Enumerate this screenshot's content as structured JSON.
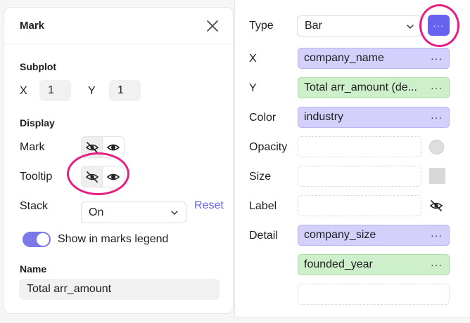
{
  "mark_panel": {
    "title": "Mark",
    "subplot": {
      "heading": "Subplot",
      "x_label": "X",
      "x_value": "1",
      "y_label": "Y",
      "y_value": "1"
    },
    "display": {
      "heading": "Display",
      "mark_label": "Mark",
      "tooltip_label": "Tooltip",
      "stack_label": "Stack",
      "stack_value": "On",
      "reset_label": "Reset"
    },
    "legend_toggle": {
      "label": "Show in marks legend",
      "on": true
    },
    "name": {
      "heading": "Name",
      "value": "Total arr_amount"
    }
  },
  "encoding_panel": {
    "type_label": "Type",
    "type_value": "Bar",
    "more_label": "···",
    "x_label": "X",
    "x_field": "company_name",
    "y_label": "Y",
    "y_field": "Total arr_amount (de...",
    "color_label": "Color",
    "color_field": "industry",
    "opacity_label": "Opacity",
    "size_label": "Size",
    "label_label": "Label",
    "detail_label": "Detail",
    "detail_fields": [
      "company_size",
      "founded_year"
    ],
    "dots": "···"
  },
  "colors": {
    "accent": "#6762f0",
    "field_purple": "#d3d1fb",
    "field_green": "#cdefc9",
    "highlight_ring": "#e81f83"
  },
  "icons": [
    "close-icon",
    "eye-off-icon",
    "eye-icon",
    "chevron-down-icon",
    "more-icon"
  ]
}
